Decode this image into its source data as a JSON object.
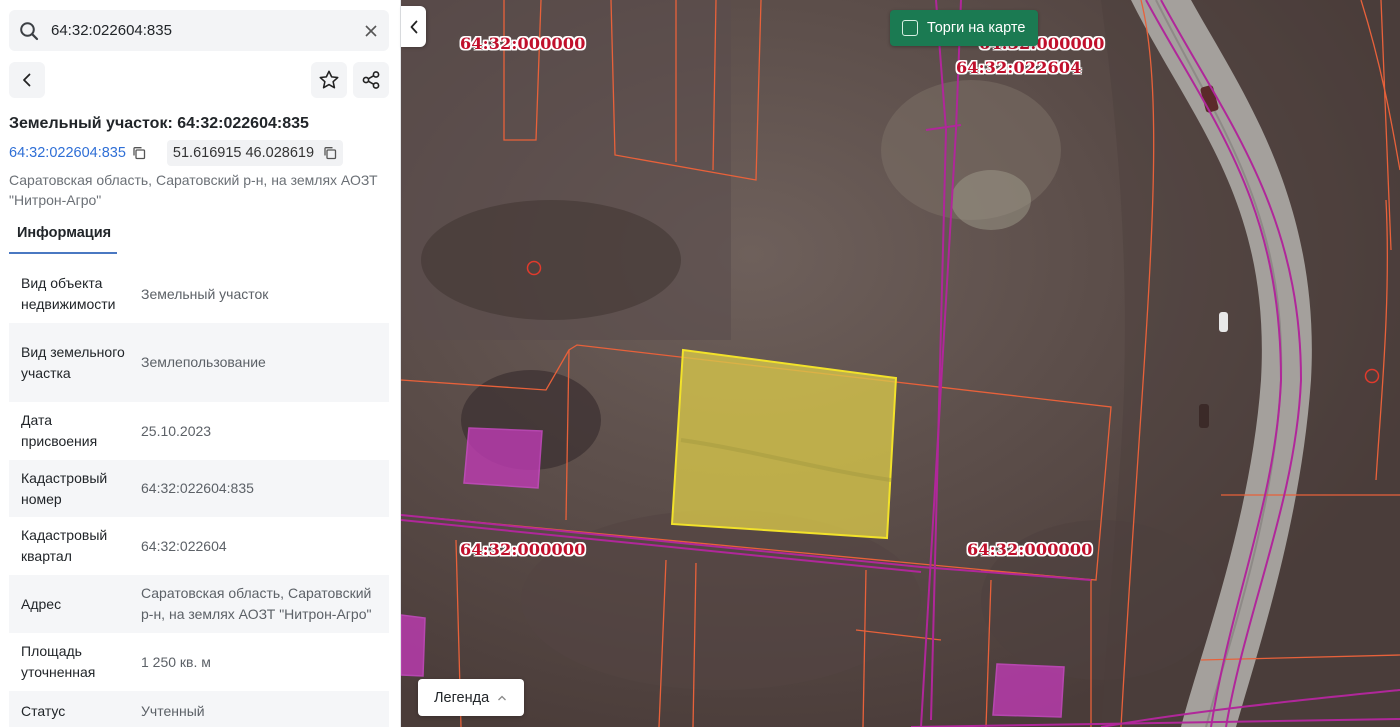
{
  "search": {
    "value": "64:32:022604:835"
  },
  "object": {
    "title": "Земельный участок: 64:32:022604:835",
    "cadastral_link": "64:32:022604:835",
    "coordinates": "51.616915 46.028619",
    "address": "Саратовская область, Саратовский р-н, на землях АОЗТ \"Нитрон-Агро\""
  },
  "tabs": [
    {
      "label": "Информация"
    }
  ],
  "info_rows": [
    {
      "key": "Вид объекта недвижимости",
      "value": "Земельный участок"
    },
    {
      "key": "Вид земельного участка",
      "value": "Землепользование"
    },
    {
      "key": "Дата присвоения",
      "value": "25.10.2023"
    },
    {
      "key": "Кадастровый номер",
      "value": "64:32:022604:835"
    },
    {
      "key": "Кадастровый квартал",
      "value": "64:32:022604"
    },
    {
      "key": "Адрес",
      "value": "Саратовская область, Саратовский р-н, на землях АОЗТ \"Нитрон-Агро\""
    },
    {
      "key": "Площадь уточненная",
      "value": "1 250 кв. м"
    },
    {
      "key": "Статус",
      "value": "Учтенный"
    }
  ],
  "map": {
    "auctions_label": "Торги на карте",
    "legend_label": "Легенда",
    "labels": {
      "top_left": "64:32:000000",
      "top_right_a": "64:32:000000",
      "top_right_b": "64:32:022604",
      "mid_left": "64:32:000000",
      "mid_right": "64:32:000000"
    }
  },
  "colors": {
    "accent_link": "#2f6fd6",
    "auctions_bg": "#1b7a52",
    "parcel_fill": "#d8c84a",
    "parcel_border": "#f2e22a",
    "boundary_orange": "#e8613a",
    "boundary_magenta": "#b0279a",
    "label_red": "#c0102c"
  }
}
